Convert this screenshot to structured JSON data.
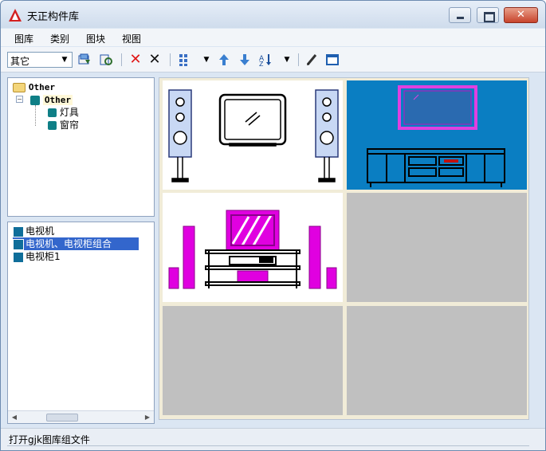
{
  "window": {
    "title": "天正构件库"
  },
  "menu": [
    "图库",
    "类别",
    "图块",
    "视图"
  ],
  "toolbar": {
    "category_value": "其它",
    "icons": [
      "open-library-icon",
      "browse-library-icon",
      "delete-red-icon",
      "delete-icon",
      "view-mode-icon",
      "move-up-icon",
      "move-down-icon",
      "sort-icon",
      "edit-icon",
      "window-icon"
    ]
  },
  "tree": {
    "root": "Other",
    "child": "Other",
    "items": [
      "灯具",
      "窗帘"
    ]
  },
  "list": {
    "items": [
      "电视机",
      "电视机、电视柜组合",
      "电视柜1"
    ],
    "selected_index": 1
  },
  "colors": {
    "selection_blue": "#3366cc",
    "cell_selected": "#0a7ec2",
    "cell_empty": "#c0c0c0",
    "magenta": "#e000e0"
  },
  "status": {
    "text": "打开gjk图库组文件"
  }
}
